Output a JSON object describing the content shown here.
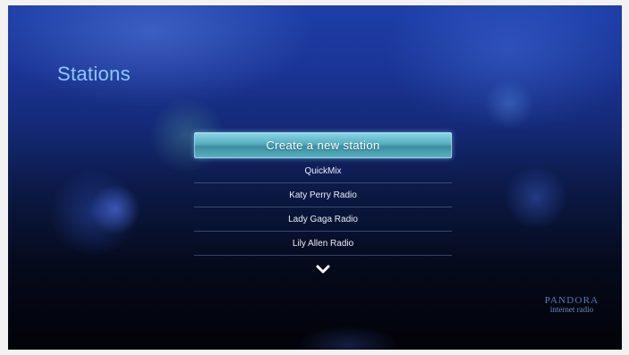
{
  "screen": {
    "title": "Stations"
  },
  "stations": {
    "create_label": "Create a new station",
    "items": [
      {
        "label": "QuickMix"
      },
      {
        "label": "Katy Perry Radio"
      },
      {
        "label": "Lady Gaga Radio"
      },
      {
        "label": "Lily Allen Radio"
      }
    ],
    "scroll_icon": "chevron-down-icon"
  },
  "branding": {
    "logo_word": "PANDORA",
    "logo_sub": "internet radio"
  },
  "colors": {
    "title": "#8ec8ff",
    "highlight": "#5ab4c4",
    "background_top": "#1d3fa8",
    "background_bottom": "#020308"
  }
}
